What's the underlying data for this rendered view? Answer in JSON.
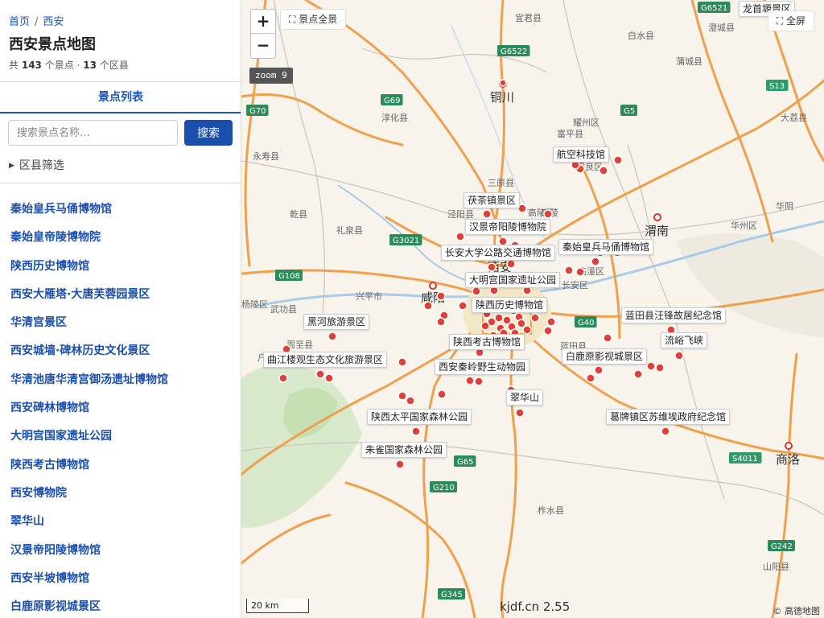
{
  "breadcrumb": [
    "首页",
    "西安"
  ],
  "title": "西安景点地图",
  "stats": {
    "prefix": "共",
    "spots": "143",
    "spots_unit": "个景点",
    "dot": "·",
    "districts": "13",
    "districts_unit": "个区县"
  },
  "tab": "景点列表",
  "search": {
    "placeholder": "搜索景点名称…",
    "button": "搜索"
  },
  "filter": "区县筛选",
  "spots": [
    "秦始皇兵马俑博物馆",
    "秦始皇帝陵博物院",
    "陕西历史博物馆",
    "西安大雁塔·大唐芙蓉园景区",
    "华清宫景区",
    "西安城墙·碑林历史文化景区",
    "华清池唐华清宫御汤遗址博物馆",
    "西安碑林博物馆",
    "大明宫国家遗址公园",
    "陕西考古博物馆",
    "西安博物院",
    "翠华山",
    "汉景帝阳陵博物馆",
    "西安半坡博物馆",
    "白鹿原影视城景区"
  ],
  "map": {
    "zoom_in": "+",
    "zoom_out": "−",
    "overview": "景点全景",
    "fullscreen": "全屏",
    "zoom_level": "zoom 9",
    "scale": "20 km",
    "version": "kjdf.cn 2.55",
    "copyright": "© 高德地图",
    "poi_labels": [
      "龙首塬景区",
      "航空科技馆",
      "茯茶镇景区",
      "汉景帝阳陵博物院",
      "长安大学公路交通博物馆",
      "秦始皇兵马俑博物馆",
      "大明宫国家遗址公园",
      "陕西历史博物馆",
      "黑河旅游景区",
      "蓝田县汪锋故居纪念馆",
      "流峪飞峡",
      "陕西考古博物馆",
      "曲江楼观生态文化旅游景区",
      "白鹿原影视城景区",
      "西安秦岭野生动物园",
      "翠华山",
      "陕西太平国家森林公园",
      "葛牌镇区苏维埃政府纪念馆",
      "朱雀国家森林公园"
    ],
    "cities": [
      "铜川",
      "咸阳",
      "渭南",
      "商洛",
      "西安"
    ],
    "towns": [
      "宜君县",
      "白水县",
      "澄城县",
      "蒲城县",
      "大荔县",
      "富平县",
      "三原县",
      "高陵区",
      "泾阳县",
      "礼泉县",
      "乾县",
      "永寿县",
      "淳化县",
      "兴平市",
      "武功县",
      "周至县",
      "户县",
      "长安区",
      "蓝田县",
      "临潼区",
      "华州区",
      "华阴",
      "柞水县",
      "山阳县",
      "耀州区",
      "阎良区",
      "杨陵区",
      "高陵"
    ],
    "roads": [
      "G6521",
      "G6522",
      "G69",
      "G70",
      "G5",
      "G3021",
      "G108",
      "G40",
      "G65",
      "G210",
      "G345",
      "S13",
      "S4011",
      "G242"
    ]
  }
}
